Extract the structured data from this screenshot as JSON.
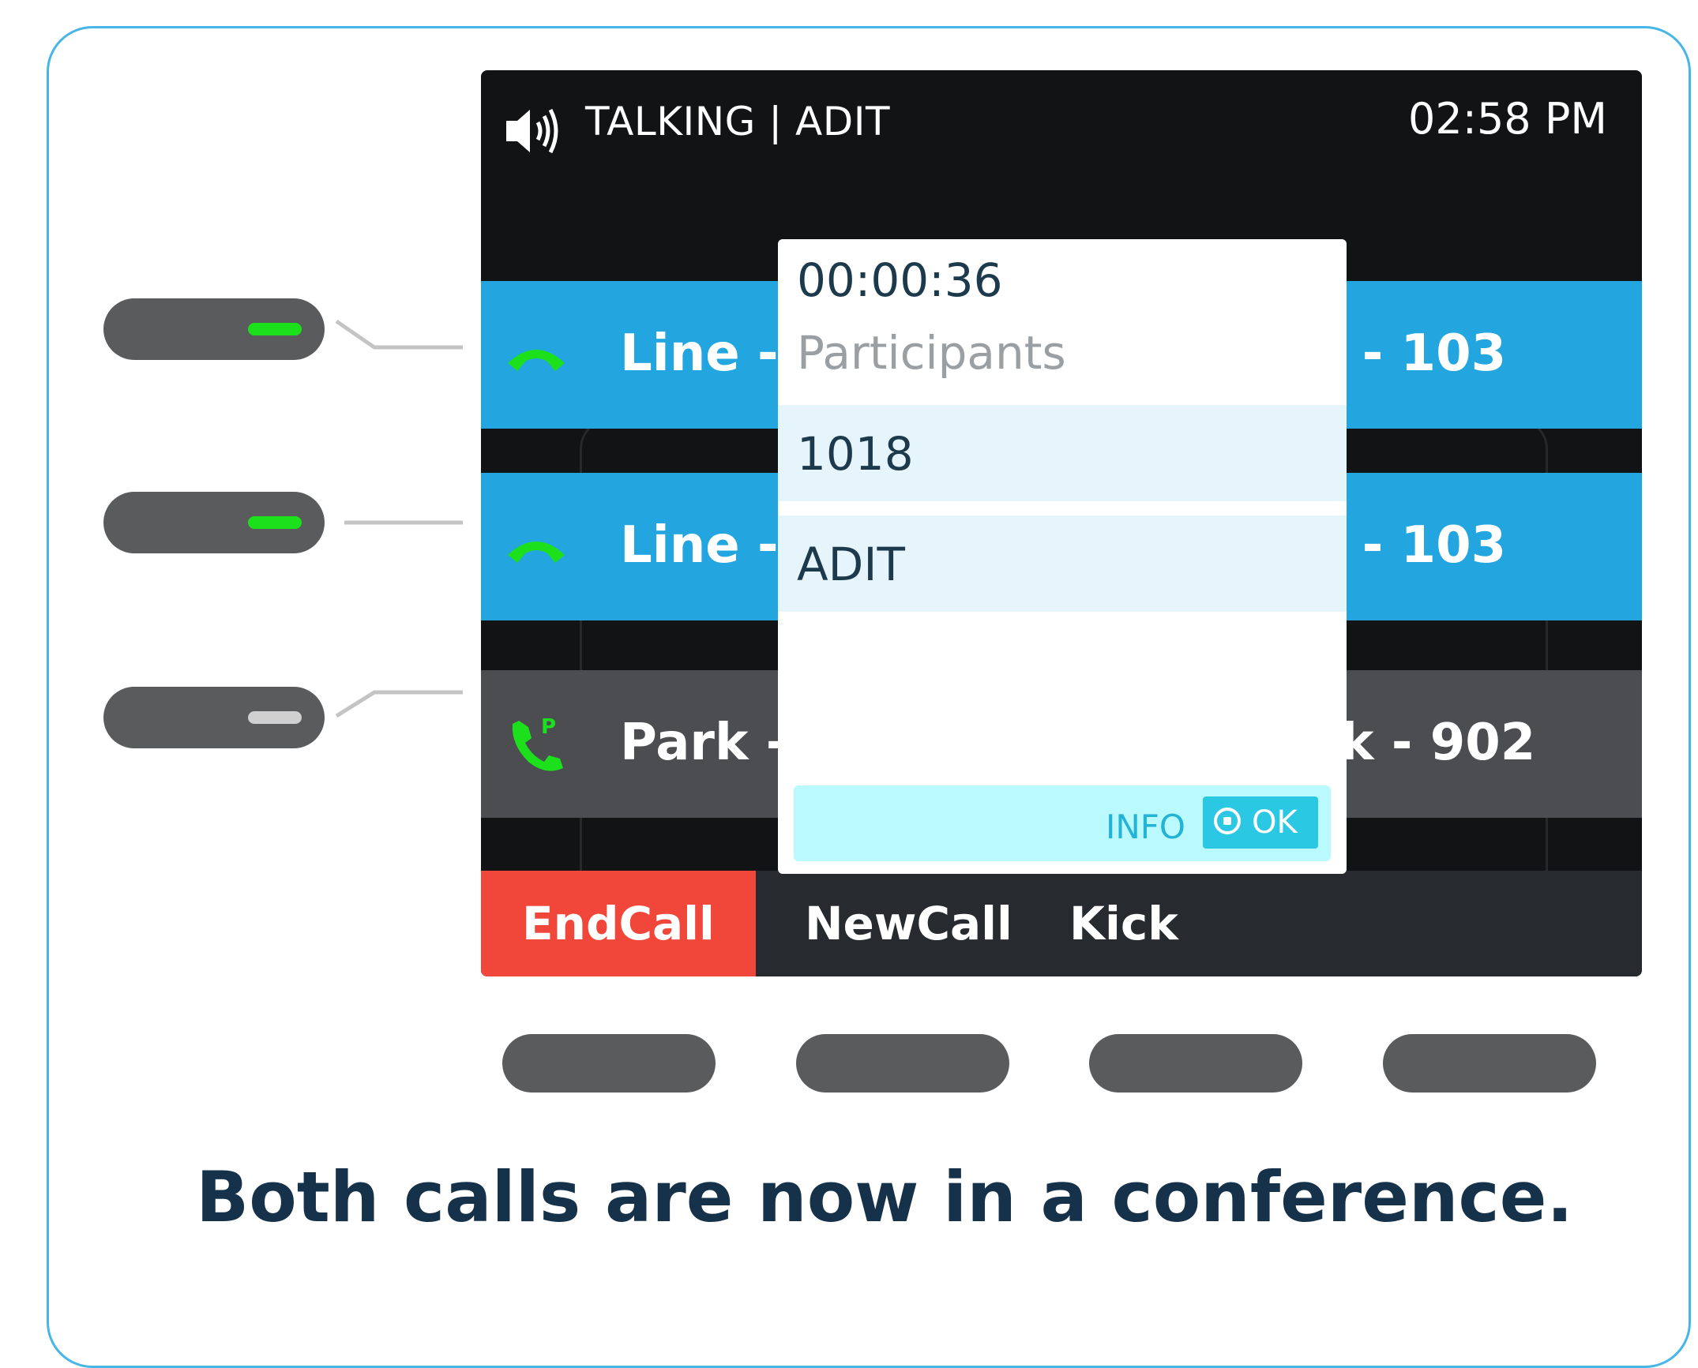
{
  "screen": {
    "status_title": "TALKING | ADIT",
    "time": "02:58 PM"
  },
  "lines": [
    {
      "icon": "handset-icon",
      "label": "Line -",
      "right_label": "e - 103",
      "style": "active"
    },
    {
      "icon": "handset-icon",
      "label": "Line -",
      "right_label": "e - 103",
      "style": "active"
    },
    {
      "icon": "park-icon",
      "label": "Park -",
      "right_label": "k - 902",
      "style": "idle"
    }
  ],
  "popup": {
    "timer": "00:00:36",
    "heading": "Participants",
    "participants": [
      "1018",
      "ADIT"
    ],
    "info_label": "INFO",
    "ok_label": "OK"
  },
  "softkeys": [
    "EndCall",
    "NewCall",
    "Kick"
  ],
  "line_keys": [
    {
      "led": "green"
    },
    {
      "led": "green"
    },
    {
      "led": "grey"
    }
  ],
  "caption": "Both calls are now in a conference.",
  "colors": {
    "border": "#47b6e6",
    "active_line": "#23a6df",
    "end_call": "#f0473a",
    "led_green": "#1de01d",
    "led_grey": "#d0d0d0"
  }
}
